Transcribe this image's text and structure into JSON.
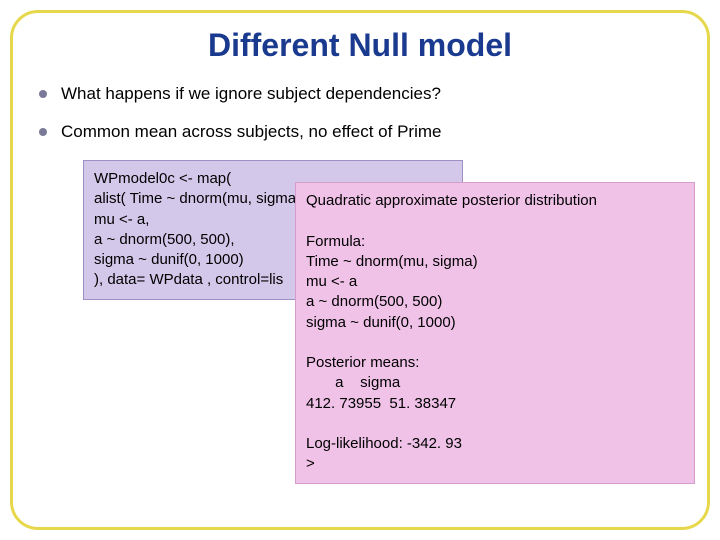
{
  "title": "Different Null model",
  "bullets": [
    "What happens if we ignore subject dependencies?",
    "Common mean across subjects, no effect of Prime"
  ],
  "codebox": "WPmodel0c <- map(\nalist( Time ~ dnorm(mu, sigma),\nmu <- a,\na ~ dnorm(500, 500),\nsigma ~ dunif(0, 1000)\n), data= WPdata , control=lis",
  "resultbox": "Quadratic approximate posterior distribution\n\nFormula:\nTime ~ dnorm(mu, sigma)\nmu <- a\na ~ dnorm(500, 500)\nsigma ~ dunif(0, 1000)\n\nPosterior means:\n       a    sigma\n412. 73955  51. 38347\n\nLog-likelihood: -342. 93\n>"
}
